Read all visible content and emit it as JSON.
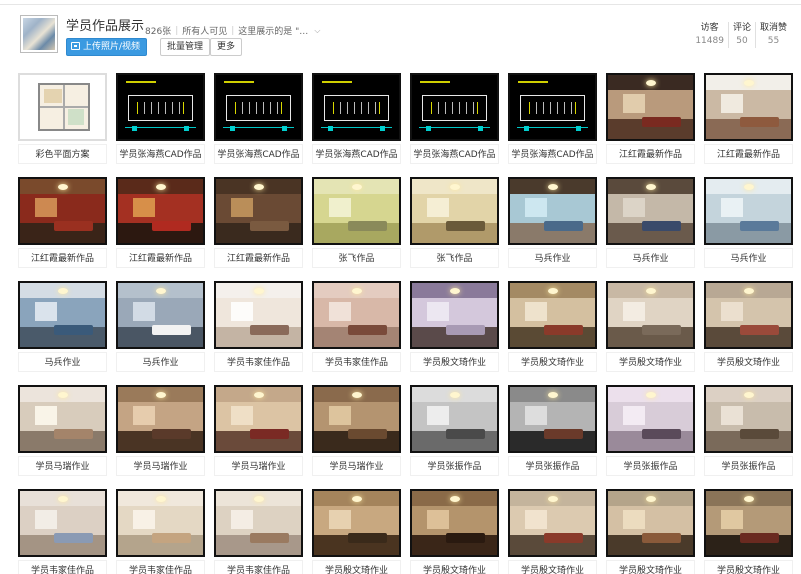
{
  "album": {
    "title": "学员作品展示",
    "count": "826张",
    "visibility": "所有人可见",
    "description": "这里展示的是 \"…",
    "upload_label": "上传照片/视频",
    "batch_label": "批量管理",
    "more_label": "更多"
  },
  "stats": [
    {
      "label": "访客",
      "value": "11489"
    },
    {
      "label": "评论",
      "value": "50"
    },
    {
      "label": "取消赞",
      "value": "55"
    }
  ],
  "photos": [
    {
      "caption": "彩色平面方案",
      "kind": "floor"
    },
    {
      "caption": "学员张海燕CAD作品",
      "kind": "cad"
    },
    {
      "caption": "学员张海燕CAD作品",
      "kind": "cad"
    },
    {
      "caption": "学员张海燕CAD作品",
      "kind": "cad"
    },
    {
      "caption": "学员张海燕CAD作品",
      "kind": "cad"
    },
    {
      "caption": "学员张海燕CAD作品",
      "kind": "cad"
    },
    {
      "caption": "江红霞最新作品",
      "kind": "room",
      "palette": [
        "#6b4a36",
        "#3a2a22",
        "#b99a7c",
        "#5a3c2c",
        "#e8d5b5",
        "#7a2a20"
      ]
    },
    {
      "caption": "江红霞最新作品",
      "kind": "room",
      "palette": [
        "#d8cfc3",
        "#f2efe9",
        "#cbb9a4",
        "#8a6a55",
        "#f7f2ea",
        "#8e5a3e"
      ]
    },
    {
      "caption": "江红霞最新作品",
      "kind": "room",
      "palette": [
        "#4a2a1c",
        "#7a4a2c",
        "#8a2a1c",
        "#3a2418",
        "#d89a5a",
        "#9a3020"
      ]
    },
    {
      "caption": "江红霞最新作品",
      "kind": "room",
      "palette": [
        "#3a1e14",
        "#5a2a1a",
        "#a43022",
        "#2c1810",
        "#e0a050",
        "#b02a20"
      ]
    },
    {
      "caption": "江红霞最新作品",
      "kind": "room",
      "palette": [
        "#2a1c14",
        "#4a3424",
        "#6a4a34",
        "#3a2a1e",
        "#c89a60",
        "#7a5a40"
      ]
    },
    {
      "caption": "张飞作品",
      "kind": "room",
      "palette": [
        "#c4c47a",
        "#e4e4b4",
        "#d6d690",
        "#a8a860",
        "#f4f4d8",
        "#8a8a5a"
      ]
    },
    {
      "caption": "张飞作品",
      "kind": "room",
      "palette": [
        "#c8b88a",
        "#efe6c8",
        "#e2d4a8",
        "#b09a6a",
        "#f8f2dc",
        "#6a5a3a"
      ]
    },
    {
      "caption": "马兵作业",
      "kind": "room",
      "palette": [
        "#6a5a4a",
        "#4a3a2c",
        "#a8c8d4",
        "#8a7a6a",
        "#d4ecf4",
        "#4a6a8a"
      ]
    },
    {
      "caption": "马兵作业",
      "kind": "room",
      "palette": [
        "#8a7a6a",
        "#5a4a3c",
        "#c4b8a8",
        "#6a5a4c",
        "#e0d8cc",
        "#3a4a6a"
      ]
    },
    {
      "caption": "马兵作业",
      "kind": "room",
      "palette": [
        "#9ab4c4",
        "#e4ecf0",
        "#c4d4dc",
        "#8a9aa4",
        "#f0f6f8",
        "#5a7a9a"
      ]
    },
    {
      "caption": "马兵作业",
      "kind": "room",
      "palette": [
        "#5a7a9a",
        "#d4dce4",
        "#8aa4bc",
        "#4a5a6a",
        "#e8eef4",
        "#3a5a7a"
      ]
    },
    {
      "caption": "马兵作业",
      "kind": "room",
      "palette": [
        "#5a6a7a",
        "#b4c0cc",
        "#9aa8b8",
        "#4a5664",
        "#dce4ec",
        "#f2f2f2"
      ]
    },
    {
      "caption": "学员韦家佳作品",
      "kind": "room",
      "palette": [
        "#e4dcd4",
        "#f4f0ec",
        "#efe6dc",
        "#c4b4a4",
        "#ffffff",
        "#8a6a5a"
      ]
    },
    {
      "caption": "学员韦家佳作品",
      "kind": "room",
      "palette": [
        "#c4a494",
        "#e4ccc0",
        "#d8b8a8",
        "#a48474",
        "#f4e8e0",
        "#7a4a3a"
      ]
    },
    {
      "caption": "学员殷文琦作业",
      "kind": "room",
      "palette": [
        "#4a3a5a",
        "#8a7a9a",
        "#d4c8dc",
        "#5a4a4a",
        "#f0ecf4",
        "#a89ab4"
      ]
    },
    {
      "caption": "学员殷文琦作业",
      "kind": "room",
      "palette": [
        "#6a5a44",
        "#a48a64",
        "#d4c0a0",
        "#5a4a34",
        "#f2e8d4",
        "#8a3a2a"
      ]
    },
    {
      "caption": "学员殷文琦作业",
      "kind": "room",
      "palette": [
        "#8a7a6a",
        "#c8b8a4",
        "#e0d4c4",
        "#6a5a4a",
        "#f6f0e8",
        "#7a6a5a"
      ]
    },
    {
      "caption": "学员殷文琦作业",
      "kind": "room",
      "palette": [
        "#7a6a5a",
        "#b8a894",
        "#d4c4ac",
        "#5a4a3a",
        "#efe4d4",
        "#9a4a3a"
      ]
    },
    {
      "caption": "学员马瑞作业",
      "kind": "room",
      "palette": [
        "#b4a494",
        "#ece4dc",
        "#d8ccbc",
        "#8a7a6a",
        "#fffaf0",
        "#a4846a"
      ]
    },
    {
      "caption": "学员马瑞作业",
      "kind": "room",
      "palette": [
        "#6a4a34",
        "#9a7a5a",
        "#c4a484",
        "#4a3424",
        "#ecd4b4",
        "#5a3a2a"
      ]
    },
    {
      "caption": "学员马瑞作业",
      "kind": "room",
      "palette": [
        "#8a6a54",
        "#c4a88a",
        "#dcc4a4",
        "#6a4a3a",
        "#f2e4cc",
        "#7a2a24"
      ]
    },
    {
      "caption": "学员马瑞作业",
      "kind": "room",
      "palette": [
        "#5a4430",
        "#8a6a4c",
        "#b49470",
        "#3a2a1c",
        "#e4cca4",
        "#6a4a30"
      ]
    },
    {
      "caption": "学员张振作品",
      "kind": "room",
      "palette": [
        "#9a9a9a",
        "#dcdcdc",
        "#c4c4c4",
        "#6a6a6a",
        "#f4f4f4",
        "#4a4a4a"
      ]
    },
    {
      "caption": "学员张振作品",
      "kind": "room",
      "palette": [
        "#4a4a4a",
        "#8a8a8a",
        "#b4b4b4",
        "#2a2a2a",
        "#e4e4e4",
        "#6a3a2a"
      ]
    },
    {
      "caption": "学员张振作品",
      "kind": "room",
      "palette": [
        "#c4b4c4",
        "#ece0ec",
        "#d8ccd8",
        "#9a8a9a",
        "#f8f0f8",
        "#5a4a5a"
      ]
    },
    {
      "caption": "学员张振作品",
      "kind": "room",
      "palette": [
        "#9a8a7a",
        "#dcd0c4",
        "#c8bcac",
        "#7a6a5a",
        "#f0e8dc",
        "#5a4a3a"
      ]
    },
    {
      "caption": "学员韦家佳作品",
      "kind": "room",
      "palette": [
        "#c4b4a4",
        "#e8e0d8",
        "#dcd0c4",
        "#a49484",
        "#f6f2ec",
        "#8a9ab4"
      ]
    },
    {
      "caption": "学员韦家佳作品",
      "kind": "room",
      "palette": [
        "#d4c4b0",
        "#f0e8dc",
        "#e4d8c4",
        "#b4a48c",
        "#fcf6ec",
        "#c4a480"
      ]
    },
    {
      "caption": "学员韦家佳作品",
      "kind": "room",
      "palette": [
        "#c8bcac",
        "#ece4d8",
        "#ddd2c2",
        "#a8988a",
        "#f8f2ea",
        "#9a7a60"
      ]
    },
    {
      "caption": "学员殷文琦作业",
      "kind": "room",
      "palette": [
        "#6a4a30",
        "#a4845c",
        "#c8a880",
        "#4a3420",
        "#ecd8b8",
        "#3a2a1a"
      ]
    },
    {
      "caption": "学员殷文琦作业",
      "kind": "room",
      "palette": [
        "#5a3a24",
        "#8a6a48",
        "#b4946c",
        "#3a2618",
        "#e4c8a0",
        "#2a1a10"
      ]
    },
    {
      "caption": "学员殷文琦作业",
      "kind": "room",
      "palette": [
        "#7a6a5a",
        "#c4b49c",
        "#dccab0",
        "#5a4a3a",
        "#f4e8d4",
        "#8a3a2a"
      ]
    },
    {
      "caption": "学员殷文琦作业",
      "kind": "room",
      "palette": [
        "#6a5a4a",
        "#b4a48a",
        "#d4c0a4",
        "#4a3a2a",
        "#f0e0c4",
        "#8a5a3a"
      ]
    },
    {
      "caption": "学员殷文琦作业",
      "kind": "room",
      "palette": [
        "#4a3a2c",
        "#8a7458",
        "#b49a78",
        "#2c2218",
        "#e8d0a8",
        "#6a2a20"
      ]
    }
  ],
  "colors": {
    "accent": "#3b9ae1",
    "thumb_border": "#111111"
  }
}
